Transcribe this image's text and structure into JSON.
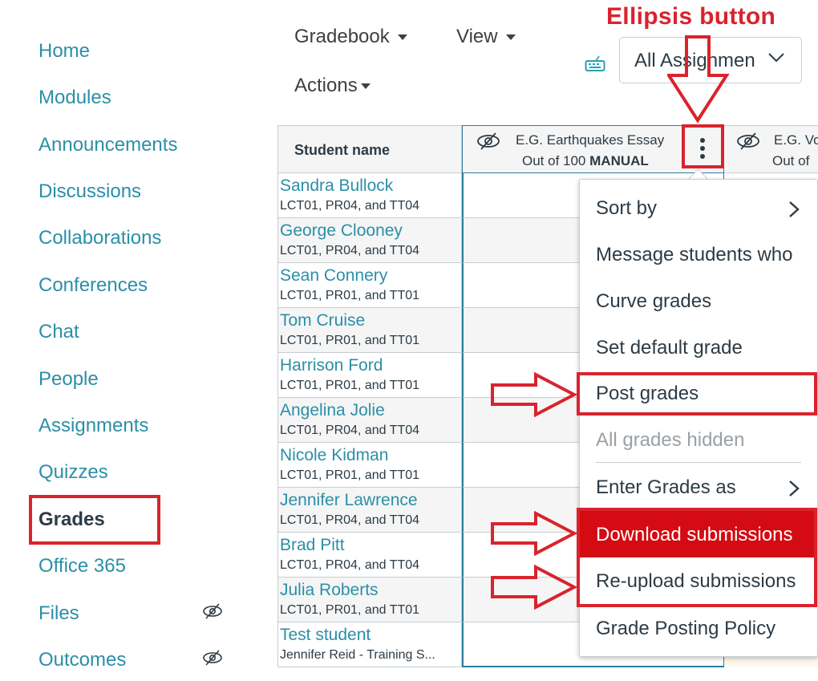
{
  "annotation": {
    "title": "Ellipsis button",
    "color": "#d9232d"
  },
  "nav": {
    "items": [
      {
        "label": "Home",
        "hidden": false,
        "active": false
      },
      {
        "label": "Modules",
        "hidden": false,
        "active": false
      },
      {
        "label": "Announcements",
        "hidden": false,
        "active": false
      },
      {
        "label": "Discussions",
        "hidden": false,
        "active": false
      },
      {
        "label": "Collaborations",
        "hidden": false,
        "active": false
      },
      {
        "label": "Conferences",
        "hidden": false,
        "active": false
      },
      {
        "label": "Chat",
        "hidden": false,
        "active": false
      },
      {
        "label": "People",
        "hidden": false,
        "active": false
      },
      {
        "label": "Assignments",
        "hidden": false,
        "active": false
      },
      {
        "label": "Quizzes",
        "hidden": false,
        "active": false
      },
      {
        "label": "Grades",
        "hidden": false,
        "active": true
      },
      {
        "label": "Office 365",
        "hidden": false,
        "active": false
      },
      {
        "label": "Files",
        "hidden": true,
        "active": false
      },
      {
        "label": "Outcomes",
        "hidden": true,
        "active": false
      }
    ],
    "link_color": "#2b8fa7"
  },
  "toolbar": {
    "gradebook": "Gradebook",
    "view": "View",
    "actions": "Actions",
    "keyboard_icon": "keyboard-icon",
    "assignment_filter": "All Assignmen"
  },
  "grid": {
    "student_header": "Student name",
    "assignment": {
      "title": "E.G. Earthquakes Essay",
      "points_prefix": "Out of 100",
      "grading": "MANUAL"
    },
    "next_assignment": {
      "title": "E.G. Vo",
      "points_prefix": "Out of"
    },
    "students": [
      {
        "name": "Sandra Bullock",
        "sections": "LCT01, PR04, and TT04"
      },
      {
        "name": "George Clooney",
        "sections": "LCT01, PR04, and TT04"
      },
      {
        "name": "Sean Connery",
        "sections": "LCT01, PR01, and TT01"
      },
      {
        "name": "Tom Cruise",
        "sections": "LCT01, PR01, and TT01"
      },
      {
        "name": "Harrison Ford",
        "sections": "LCT01, PR01, and TT01"
      },
      {
        "name": "Angelina Jolie",
        "sections": "LCT01, PR04, and TT04"
      },
      {
        "name": "Nicole Kidman",
        "sections": "LCT01, PR01, and TT01"
      },
      {
        "name": "Jennifer Lawrence",
        "sections": "LCT01, PR04, and TT04"
      },
      {
        "name": "Brad Pitt",
        "sections": "LCT01, PR04, and TT04"
      },
      {
        "name": "Julia Roberts",
        "sections": "LCT01, PR01, and TT01"
      },
      {
        "name": "Test student",
        "sections": "Jennifer Reid - Training S..."
      }
    ]
  },
  "menu": {
    "items": [
      {
        "label": "Sort by",
        "submenu": true,
        "disabled": false
      },
      {
        "label": "Message students who",
        "submenu": false,
        "disabled": false
      },
      {
        "label": "Curve grades",
        "submenu": false,
        "disabled": false
      },
      {
        "label": "Set default grade",
        "submenu": false,
        "disabled": false
      },
      {
        "label": "Post grades",
        "submenu": false,
        "disabled": false
      },
      {
        "label": "All grades hidden",
        "submenu": false,
        "disabled": true
      },
      {
        "label": "Enter Grades as",
        "submenu": true,
        "disabled": false
      },
      {
        "label": "Download submissions",
        "submenu": false,
        "disabled": false,
        "highlighted": true
      },
      {
        "label": "Re-upload submissions",
        "submenu": false,
        "disabled": false
      },
      {
        "label": "Grade Posting Policy",
        "submenu": false,
        "disabled": false
      }
    ],
    "highlight_color": "#d40b12"
  }
}
